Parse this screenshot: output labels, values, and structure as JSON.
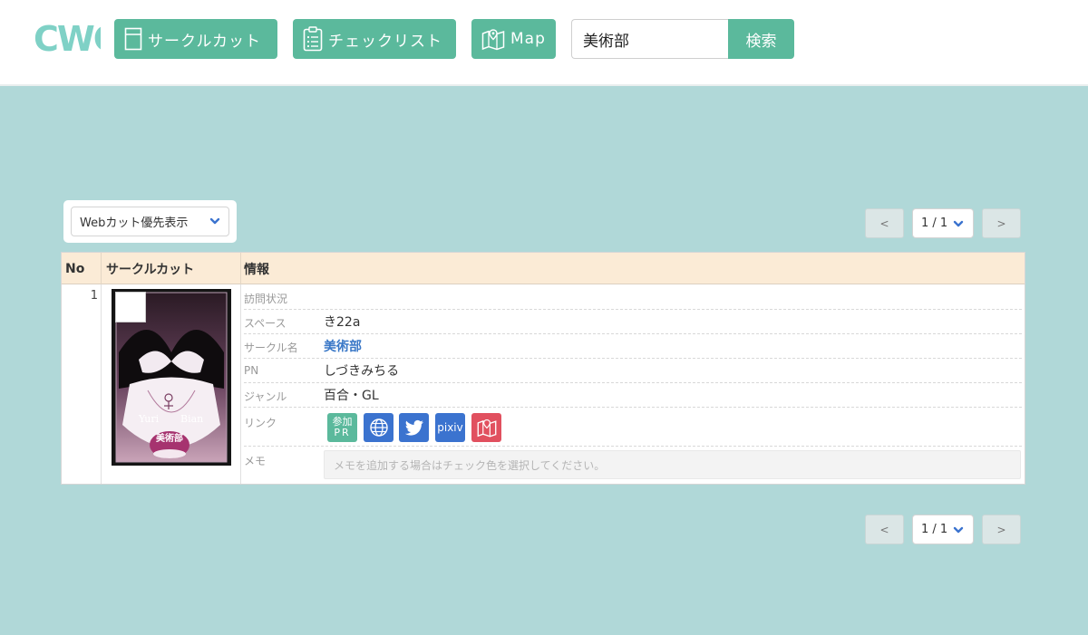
{
  "header": {
    "logo_text": "CWC",
    "nav": {
      "circle_cut": "サークルカット",
      "checklist": "チェックリスト",
      "map": "Map"
    },
    "search": {
      "value": "美術部",
      "button": "検索"
    }
  },
  "toolbar": {
    "sort_label": "Webカット優先表示"
  },
  "pager": {
    "prev": "<",
    "page": "1 / 1",
    "next": ">"
  },
  "table": {
    "headers": {
      "no": "No",
      "cut": "サークルカット",
      "info": "情報"
    },
    "row": {
      "no": "1",
      "labels": {
        "visit": "訪問状況",
        "space": "スペース",
        "circle": "サークル名",
        "pn": "PN",
        "genre": "ジャンル",
        "links": "リンク",
        "memo": "メモ"
      },
      "values": {
        "space": "き22a",
        "circle": "美術部",
        "pn": "しづきみちる",
        "genre": "百合・GL"
      },
      "link_buttons": {
        "pr_top": "参加",
        "pr_bottom": "PR",
        "pixiv": "pixiv"
      },
      "memo_placeholder": "メモを追加する場合はチェック色を選択してください。",
      "cut_image": {
        "text_left": "Yuri",
        "text_right": "Bian",
        "stamp": "美術部"
      }
    }
  },
  "colors": {
    "accent": "#5bb99c",
    "background": "#b0d8d8",
    "header_row": "#fbebd6",
    "link_blue": "#3a78c7",
    "map_red": "#e1505f",
    "icon_blue": "#3b73cf"
  }
}
